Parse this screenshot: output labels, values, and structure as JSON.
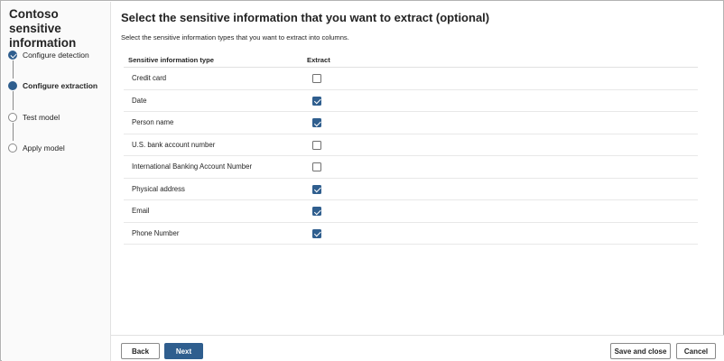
{
  "sidebar": {
    "title": "Contoso sensitive information",
    "steps": [
      {
        "label": "Configure detection",
        "state": "done"
      },
      {
        "label": "Configure extraction",
        "state": "current"
      },
      {
        "label": "Test model",
        "state": "pending"
      },
      {
        "label": "Apply model",
        "state": "pending"
      }
    ]
  },
  "main": {
    "title": "Select the sensitive information that you want to extract (optional)",
    "description": "Select the sensitive information types that you want to extract into columns.",
    "table": {
      "headers": {
        "type": "Sensitive information type",
        "extract": "Extract"
      },
      "rows": [
        {
          "name": "Credit card",
          "checked": false
        },
        {
          "name": "Date",
          "checked": true
        },
        {
          "name": "Person name",
          "checked": true
        },
        {
          "name": "U.S. bank account number",
          "checked": false
        },
        {
          "name": "International Banking Account Number",
          "checked": false
        },
        {
          "name": "Physical address",
          "checked": true
        },
        {
          "name": "Email",
          "checked": true
        },
        {
          "name": "Phone Number",
          "checked": true
        }
      ]
    }
  },
  "footer": {
    "back_label": "Back",
    "next_label": "Next",
    "save_label": "Save and close",
    "cancel_label": "Cancel"
  },
  "colors": {
    "accent": "#2f5e8e",
    "border": "#e1e1e1",
    "sidebar_bg": "#fafafa"
  }
}
